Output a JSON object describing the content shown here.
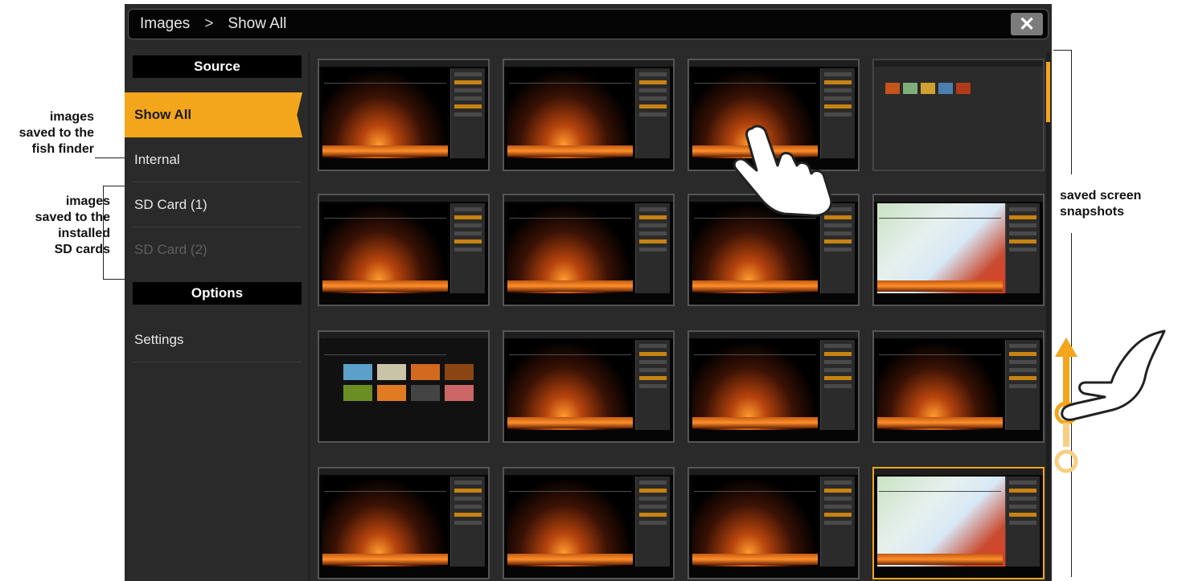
{
  "breadcrumb": {
    "root": "Images",
    "separator": ">",
    "current": "Show All"
  },
  "close_icon": "close-icon",
  "sidebar": {
    "source_header": "Source",
    "items": [
      {
        "label": "Show All",
        "state": "selected"
      },
      {
        "label": "Internal",
        "state": "normal"
      },
      {
        "label": "SD Card (1)",
        "state": "normal"
      },
      {
        "label": "SD Card (2)",
        "state": "disabled"
      }
    ],
    "options_header": "Options",
    "settings_label": "Settings"
  },
  "annotations": {
    "internal": [
      "images",
      "saved to the",
      "fish finder"
    ],
    "sd_cards": [
      "images",
      "saved to the",
      "installed",
      "SD cards"
    ],
    "snapshots": [
      "saved screen",
      "snapshots"
    ]
  },
  "thumbnails": [
    {
      "kind": "sonar"
    },
    {
      "kind": "sonar"
    },
    {
      "kind": "sonar"
    },
    {
      "kind": "gallery"
    },
    {
      "kind": "sonar"
    },
    {
      "kind": "sonar"
    },
    {
      "kind": "sonar"
    },
    {
      "kind": "map"
    },
    {
      "kind": "home"
    },
    {
      "kind": "sonar"
    },
    {
      "kind": "sonar"
    },
    {
      "kind": "sonar"
    },
    {
      "kind": "sonar"
    },
    {
      "kind": "sonar"
    },
    {
      "kind": "sonar"
    },
    {
      "kind": "map"
    }
  ],
  "colors": {
    "accent": "#f3a51b",
    "background": "#2a2a2a",
    "titlebar": "#050505"
  },
  "icons": [
    "tap-hand-icon",
    "swipe-up-hand-icon",
    "swipe-arrow-icon"
  ]
}
